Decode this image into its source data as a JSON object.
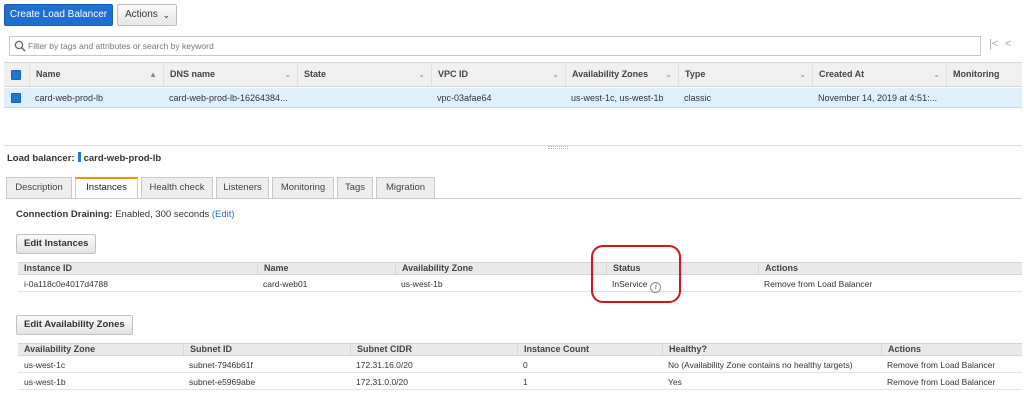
{
  "toolbar": {
    "create_label": "Create Load Balancer",
    "actions_label": "Actions",
    "actions_caret": "⌄"
  },
  "search": {
    "placeholder": "Filter by tags and attributes or search by keyword"
  },
  "pager": {
    "first": "|<",
    "prev": "<"
  },
  "lb_table": {
    "columns": [
      "Name",
      "DNS name",
      "State",
      "VPC ID",
      "Availability Zones",
      "Type",
      "Created At",
      "Monitoring"
    ],
    "sort_indicators": [
      "▲",
      "⌄",
      "⌄",
      "⌄",
      "⌄",
      "⌄",
      "⌄"
    ],
    "row": {
      "name": "card-web-prod-lb",
      "dns": "card-web-prod-lb-16264384...",
      "state": "",
      "vpc": "vpc-03afae64",
      "zones": "us-west-1c, us-west-1b",
      "type": "classic",
      "created": "November 14, 2019 at 4:51:...",
      "monitoring": ""
    }
  },
  "detail": {
    "label": "Load balancer:",
    "name": "card-web-prod-lb"
  },
  "tabs": [
    "Description",
    "Instances",
    "Health check",
    "Listeners",
    "Monitoring",
    "Tags",
    "Migration"
  ],
  "active_tab": "Instances",
  "draining": {
    "label": "Connection Draining:",
    "value": "Enabled, 300 seconds",
    "edit": "(Edit)"
  },
  "edit_instances_label": "Edit Instances",
  "instances_table": {
    "columns": [
      "Instance ID",
      "Name",
      "Availability Zone",
      "Status",
      "Actions"
    ],
    "rows": [
      {
        "id": "i-0a118c0e4017d4788",
        "name": "card-web01",
        "zone": "us-west-1b",
        "status": "InService",
        "action": "Remove from Load Balancer"
      }
    ]
  },
  "info_icon_glyph": "i",
  "edit_zones_label": "Edit Availability Zones",
  "zones_table": {
    "columns": [
      "Availability Zone",
      "Subnet ID",
      "Subnet CIDR",
      "Instance Count",
      "Healthy?",
      "Actions"
    ],
    "rows": [
      {
        "zone": "us-west-1c",
        "subnet": "subnet-7946b61f",
        "cidr": "172.31.16.0/20",
        "count": "0",
        "healthy": "No (Availability Zone contains no healthy targets)",
        "action": "Remove from Load Balancer"
      },
      {
        "zone": "us-west-1b",
        "subnet": "subnet-e5969abe",
        "cidr": "172.31.0.0/20",
        "count": "1",
        "healthy": "Yes",
        "action": "Remove from Load Balancer"
      }
    ]
  },
  "colors": {
    "primary": "#1f6fd1",
    "selected_row": "#dff0fd",
    "active_tab_accent": "#e8940c",
    "highlight": "#d9101e"
  }
}
